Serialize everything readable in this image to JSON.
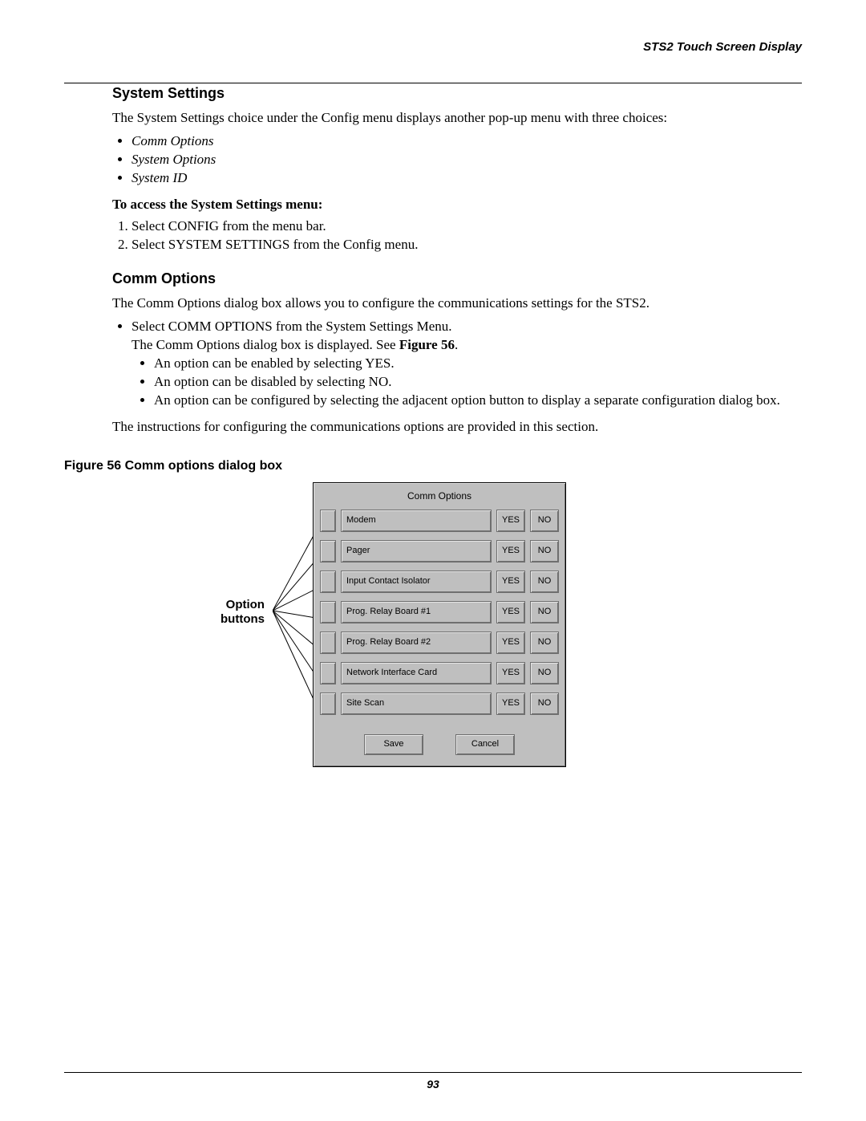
{
  "running_head": "STS2 Touch Screen Display",
  "section1": {
    "title": "System Settings",
    "intro": "The System Settings choice under the Config menu displays another pop-up menu with three choices:",
    "bullets": [
      "Comm Options",
      "System Options",
      "System ID"
    ],
    "access_head": "To access the System Settings menu:",
    "steps": [
      "Select CONFIG from the menu bar.",
      "Select SYSTEM SETTINGS from the Config menu."
    ]
  },
  "section2": {
    "title": "Comm Options",
    "intro": "The Comm Options dialog box allows you to configure the communications settings for the STS2.",
    "step": "Select COMM OPTIONS from the System Settings Menu.",
    "displayed_before": "The Comm Options dialog box is displayed. See ",
    "fig_ref": "Figure 56",
    "displayed_after": ".",
    "sub_bullets": [
      "An option can be enabled by selecting YES.",
      "An option can be disabled by selecting NO.",
      "An option can be configured by selecting the adjacent option button to display a separate configuration dialog box."
    ],
    "outro": "The instructions for configuring the communications options are provided in this section."
  },
  "figure": {
    "caption": "Figure 56  Comm options dialog box",
    "callout_line1": "Option",
    "callout_line2": "buttons",
    "dialog_title": "Comm Options",
    "rows": [
      {
        "label": "Modem",
        "yes": "YES",
        "no": "NO"
      },
      {
        "label": "Pager",
        "yes": "YES",
        "no": "NO"
      },
      {
        "label": "Input Contact Isolator",
        "yes": "YES",
        "no": "NO"
      },
      {
        "label": "Prog. Relay Board #1",
        "yes": "YES",
        "no": "NO"
      },
      {
        "label": "Prog. Relay Board #2",
        "yes": "YES",
        "no": "NO"
      },
      {
        "label": "Network Interface Card",
        "yes": "YES",
        "no": "NO"
      },
      {
        "label": "Site Scan",
        "yes": "YES",
        "no": "NO"
      }
    ],
    "save": "Save",
    "cancel": "Cancel"
  },
  "page_number": "93"
}
